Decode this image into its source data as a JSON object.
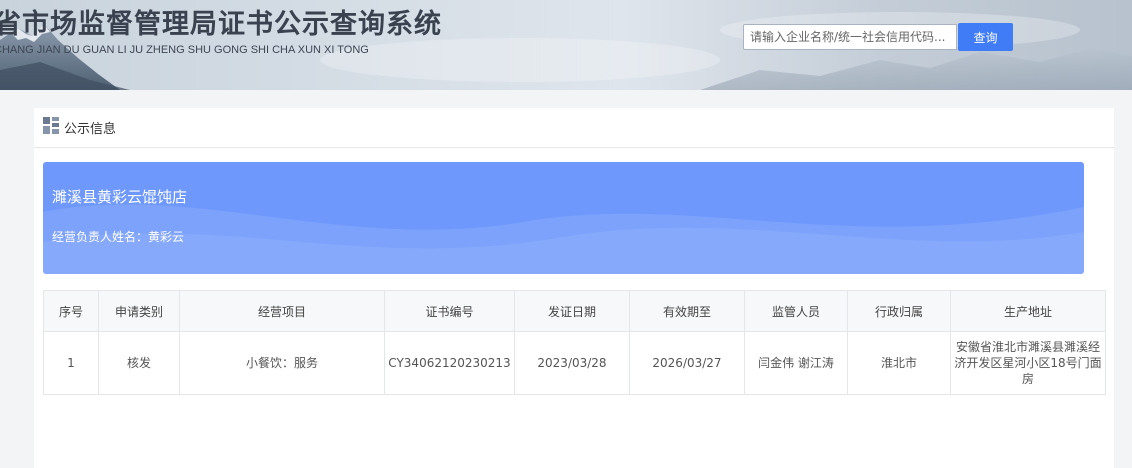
{
  "header": {
    "title": "省市场监督管理局证书公示查询系统",
    "subtitle": "CHANG JIAN DU GUAN LI JU ZHENG SHU GONG SHI CHA XUN XI TONG",
    "search_placeholder": "请输入企业名称/统一社会信用代码...",
    "search_button_label": "查询"
  },
  "section": {
    "title": "公示信息",
    "icon": "list-grid-icon"
  },
  "company": {
    "name": "濉溪县黄彩云馄饨店",
    "operator_label": "经营负责人姓名：",
    "operator_name": "黄彩云"
  },
  "table": {
    "headers": [
      "序号",
      "申请类别",
      "经营项目",
      "证书编号",
      "发证日期",
      "有效期至",
      "监管人员",
      "行政归属",
      "生产地址"
    ],
    "rows": [
      {
        "index": "1",
        "category": "核发",
        "business_item": "小餐饮：服务",
        "cert_no": "CY34062120230213",
        "issue_date": "2023/03/28",
        "valid_until": "2026/03/27",
        "supervisors": "闫金伟 谢江涛",
        "admin_region": "淮北市",
        "address": "安徽省淮北市濉溪县濉溪经济开发区星河小区18号门面房"
      }
    ]
  },
  "colors": {
    "accent_button": "#3f7cf5",
    "banner_blue": "#6e98fb"
  }
}
